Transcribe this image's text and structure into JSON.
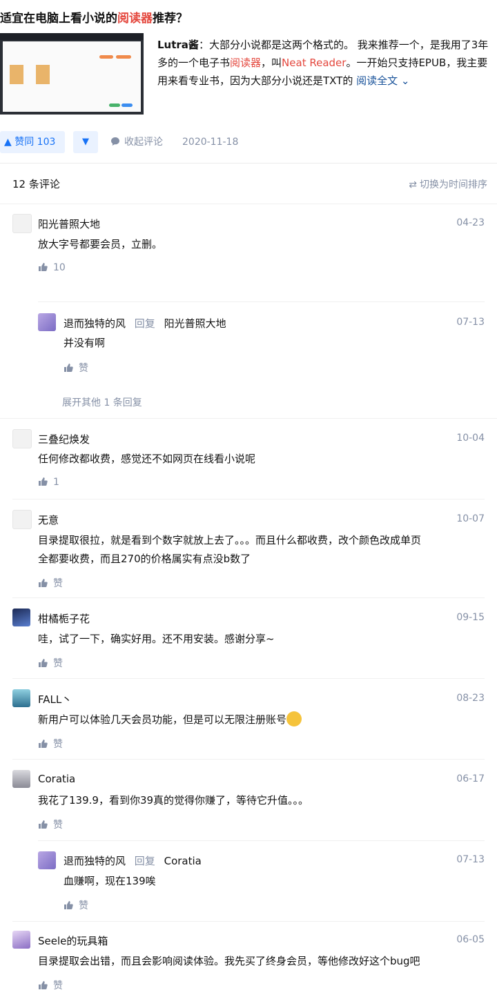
{
  "question": {
    "title_prefix": "适宜在电脑上看小说的",
    "title_highlight": "阅读器",
    "title_suffix": "推荐？"
  },
  "answer": {
    "line1_author": "Lutra酱",
    "line1_rest": "：大部分小说都是这两个格式的。 我来推荐一个，是我用了3年",
    "line2_a": "多的一个电子书",
    "line2_red1": "阅读器",
    "line2_b": "，叫",
    "line2_red2": "Neat Reader",
    "line2_c": "。一开始只支持EPUB，我主要",
    "line3": "用来看专业书，因为大部分小说还是TXT的",
    "read_more": "阅读全文 ⌄"
  },
  "actions": {
    "vote_label": "▲ 赞同 103",
    "down_label": "▼",
    "collapse_label": "收起评论",
    "date": "2020-11-18"
  },
  "comments_header": {
    "count": "12 条评论",
    "sort": "切换为时间排序"
  },
  "comments": [
    {
      "name": "阳光普照大地",
      "time": "04-23",
      "text": "放大字号都要会员，立删。",
      "likes": "10"
    },
    {
      "name": "退而独特的风",
      "reply_word": "回复",
      "reply_to": "阳光普照大地",
      "time": "07-13",
      "text": "并没有啊",
      "likes": "赞"
    },
    {
      "expand": "展开其他 1 条回复"
    },
    {
      "name": "三叠纪焕发",
      "time": "10-04",
      "text": "任何修改都收费，感觉还不如网页在线看小说呢",
      "likes": "1"
    },
    {
      "name": "无意",
      "time": "10-07",
      "text": "目录提取很拉，就是看到个数字就放上去了。。。而且什么都收费，改个颜色改成单页",
      "text2": "全都要收费，而且270的价格属实有点没b数了",
      "likes": "赞"
    },
    {
      "name": "柑橘栀子花",
      "time": "09-15",
      "text": "哇，试了一下，确实好用。还不用安装。感谢分享~",
      "likes": "赞"
    },
    {
      "name": "FALL丶",
      "time": "08-23",
      "text": "新用户可以体验几天会员功能，但是可以无限注册账号",
      "likes": "赞"
    },
    {
      "name": "Coratia",
      "time": "06-17",
      "text": "我花了139.9，看到你39真的觉得你赚了，等待它升值。。。",
      "likes": "赞"
    },
    {
      "name": "退而独特的风",
      "reply_word": "回复",
      "reply_to": "Coratia",
      "time": "07-13",
      "text": "血赚啊，现在139唉",
      "likes": "赞"
    },
    {
      "name": "Seele的玩具箱",
      "time": "06-05",
      "text": "目录提取会出错，而且会影响阅读体验。我先买了终身会员，等他修改好这个bug吧",
      "likes": "赞"
    }
  ],
  "colors": {
    "accent": "#1772f6",
    "highlight": "#e4473d",
    "muted": "#8590a6",
    "link": "#175199"
  }
}
